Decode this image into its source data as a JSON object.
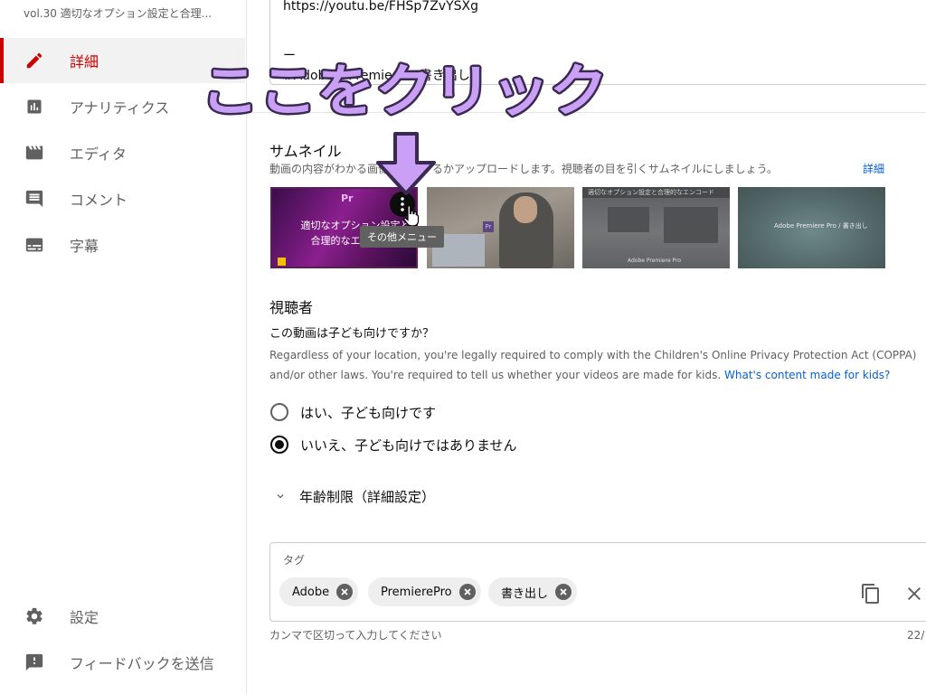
{
  "sidebar": {
    "video_title": "vol.30 適切なオプション設定と合理...",
    "items": [
      {
        "label": "詳細",
        "icon": "pencil-icon",
        "active": true
      },
      {
        "label": "アナリティクス",
        "icon": "analytics-icon",
        "active": false
      },
      {
        "label": "エディタ",
        "icon": "clapperboard-icon",
        "active": false
      },
      {
        "label": "コメント",
        "icon": "comment-icon",
        "active": false
      },
      {
        "label": "字幕",
        "icon": "subtitles-icon",
        "active": false
      }
    ],
    "footer_items": [
      {
        "label": "設定",
        "icon": "gear-icon"
      },
      {
        "label": "フィードバックを送信",
        "icon": "feedback-icon"
      }
    ]
  },
  "description": {
    "line1": "https://youtu.be/FHSp7ZvYSXg",
    "line2": "ー",
    "line3": "#Adobe #Premiere #書き出し"
  },
  "annotation": {
    "callout": "ここをクリック",
    "color": "#c9a0f5"
  },
  "thumbnail": {
    "heading": "サムネイル",
    "description": "動画の内容がわかる画像を選択するかアップロードします。視聴者の目を引くサムネイルにしましょう。",
    "link": "詳細",
    "tooltip": "その他メニュー",
    "thumb1": {
      "pr": "Pr",
      "line1": "適切なオプション設定と",
      "line2": "合理的なエンコード"
    },
    "thumb2": {
      "pr": "Pr"
    },
    "thumb3": {
      "bar": "適切なオプション設定と合理的なエンコード",
      "foot": "Adobe Premiere Pro"
    },
    "thumb4": {
      "text": "Adobe Premiere Pro / 書き出し"
    }
  },
  "audience": {
    "heading": "視聴者",
    "question": "この動画は子ども向けですか？",
    "legal_line1": "Regardless of your location, you're legally required to comply with the Children's Online Privacy Protection Act (COPPA)",
    "legal_line2": "and/or other laws. You're required to tell us whether your videos are made for kids.",
    "legal_link": "What's content made for kids?",
    "options": [
      {
        "label": "はい、子ども向けです",
        "selected": false
      },
      {
        "label": "いいえ、子ども向けではありません",
        "selected": true
      }
    ],
    "age_restriction": "年齢制限（詳細設定）"
  },
  "tags": {
    "label": "タグ",
    "chips": [
      "Adobe",
      "PremierePro",
      "書き出し"
    ],
    "hint": "カンマで区切って入力してください",
    "count": "22/"
  },
  "colors": {
    "accent_red": "#cc0000",
    "link_blue": "#065fd4",
    "annotation_purple": "#c9a0f5"
  }
}
